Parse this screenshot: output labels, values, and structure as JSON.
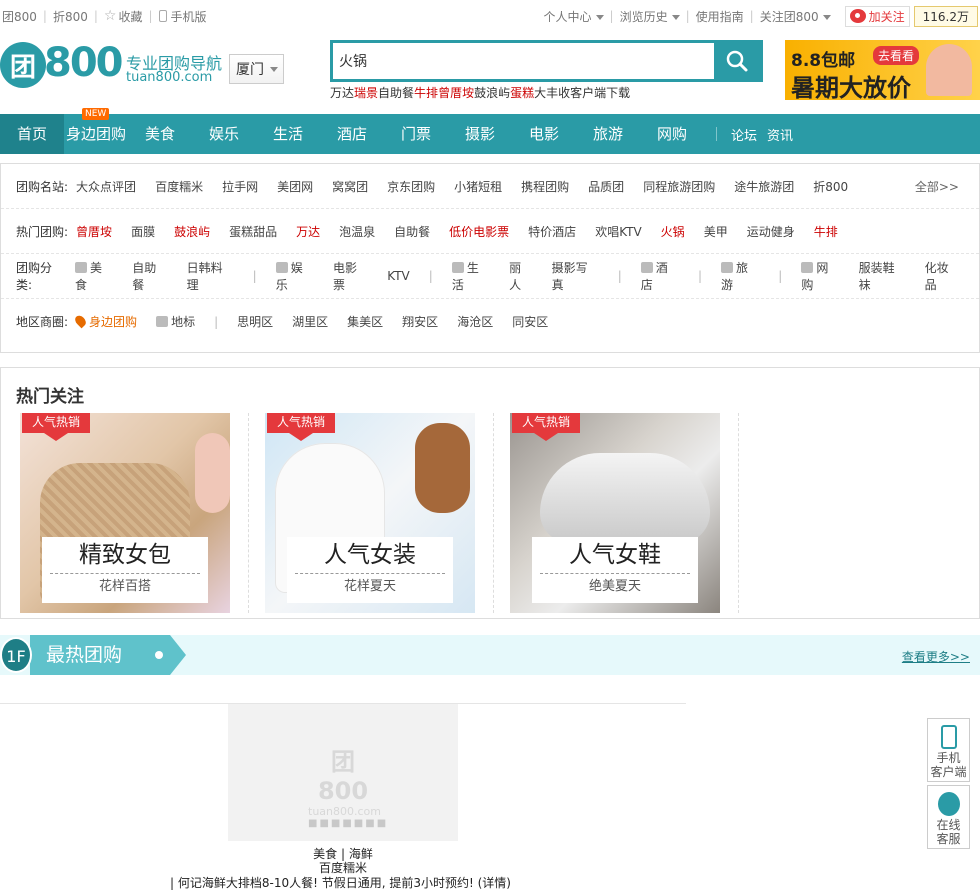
{
  "topbar": {
    "left": [
      "团800",
      "折800",
      "收藏",
      "手机版"
    ],
    "right": [
      "个人中心",
      "浏览历史",
      "使用指南",
      "关注团800"
    ],
    "follow": "加关注",
    "fans": "116.2万"
  },
  "header": {
    "logo_circle": "团",
    "logo_num": "800",
    "slogan": "专业团购导航",
    "domain": "tuan800.com",
    "city": "厦门",
    "search_value": "火锅",
    "hotwords": [
      {
        "t": "万达",
        "red": false
      },
      {
        "t": "瑞景",
        "red": true
      },
      {
        "t": "自助餐",
        "red": false
      },
      {
        "t": "牛排",
        "red": true
      },
      {
        "t": "曾厝垵",
        "red": true
      },
      {
        "t": "鼓浪屿",
        "red": false
      },
      {
        "t": "蛋糕",
        "red": true
      },
      {
        "t": "大丰收",
        "red": false
      },
      {
        "t": "客户端下载",
        "red": false
      }
    ],
    "banner": {
      "line1": "8.8包邮",
      "go": "去看看",
      "line2": "暑期大放价"
    }
  },
  "nav": {
    "items": [
      "首页",
      "身边团购",
      "美食",
      "娱乐",
      "生活",
      "酒店",
      "门票",
      "摄影",
      "电影",
      "旅游",
      "网购"
    ],
    "new_badge": "NEW",
    "extra": [
      "论坛",
      "资讯"
    ]
  },
  "categories": {
    "row1": {
      "label": "团购名站:",
      "items": [
        "大众点评团",
        "百度糯米",
        "拉手网",
        "美团网",
        "窝窝团",
        "京东团购",
        "小猪短租",
        "携程团购",
        "品质团",
        "同程旅游团购",
        "途牛旅游团",
        "折800"
      ],
      "more": "全部>>"
    },
    "row2": {
      "label": "热门团购:",
      "items": [
        {
          "t": "曾厝垵",
          "c": "red"
        },
        {
          "t": "面膜",
          "c": ""
        },
        {
          "t": "鼓浪屿",
          "c": "red"
        },
        {
          "t": "蛋糕甜品",
          "c": ""
        },
        {
          "t": "万达",
          "c": "red"
        },
        {
          "t": "泡温泉",
          "c": ""
        },
        {
          "t": "自助餐",
          "c": ""
        },
        {
          "t": "低价电影票",
          "c": "red"
        },
        {
          "t": "特价酒店",
          "c": ""
        },
        {
          "t": "欢唱KTV",
          "c": ""
        },
        {
          "t": "火锅",
          "c": "red"
        },
        {
          "t": "美甲",
          "c": ""
        },
        {
          "t": "运动健身",
          "c": ""
        },
        {
          "t": "牛排",
          "c": "red"
        }
      ]
    },
    "row3": {
      "label": "团购分类:",
      "groups": [
        [
          "美食",
          "自助餐",
          "日韩料理"
        ],
        [
          "娱乐",
          "电影票",
          "KTV"
        ],
        [
          "生活",
          "丽人",
          "摄影写真"
        ],
        [
          "酒店"
        ],
        [
          "旅游"
        ],
        [
          "网购",
          "服装鞋袜",
          "化妆品"
        ]
      ]
    },
    "row4": {
      "label": "地区商圈:",
      "near": "身边团购",
      "landmark": "地标",
      "items": [
        "思明区",
        "湖里区",
        "集美区",
        "翔安区",
        "海沧区",
        "同安区"
      ]
    }
  },
  "hot": {
    "title": "热门关注",
    "tag": "人气热销",
    "cards": [
      {
        "big": "精致女包",
        "sub": "花样百搭"
      },
      {
        "big": "人气女装",
        "sub": "花样夏天"
      },
      {
        "big": "人气女鞋",
        "sub": "绝美夏天"
      }
    ]
  },
  "floor": {
    "num": "1F",
    "name": "最热团购",
    "more": "查看更多>>"
  },
  "deal": {
    "placeholder_logo": "团800",
    "placeholder_domain": "tuan800.com",
    "category": "美食 | 海鲜",
    "source": "百度糯米",
    "desc": "| 何记海鲜大排档8-10人餐! 节假日通用, 提前3小时预约! (详情)"
  },
  "side": [
    {
      "l1": "手机",
      "l2": "客户端"
    },
    {
      "l1": "在线",
      "l2": "客服"
    }
  ]
}
